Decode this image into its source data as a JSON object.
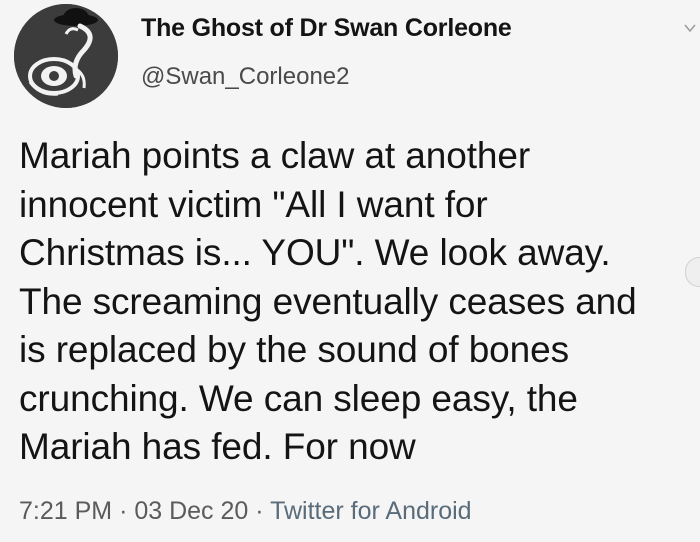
{
  "tweet": {
    "author": {
      "display_name": "The Ghost of Dr Swan Corleone",
      "handle": "@Swan_Corleone2",
      "avatar_icon": "swan-drawing-avatar-icon"
    },
    "text": "Mariah points a claw at another\ninnocent victim \"All I want for\nChristmas is... YOU\". We look away.\nThe screaming eventually ceases and\nis replaced by the sound of bones\ncrunching. We can sleep easy, the\nMariah has fed. For now",
    "time": "7:21 PM",
    "separator": "·",
    "date": "03 Dec 20",
    "source": "Twitter for Android",
    "menu_icon": "chevron-down-icon"
  }
}
